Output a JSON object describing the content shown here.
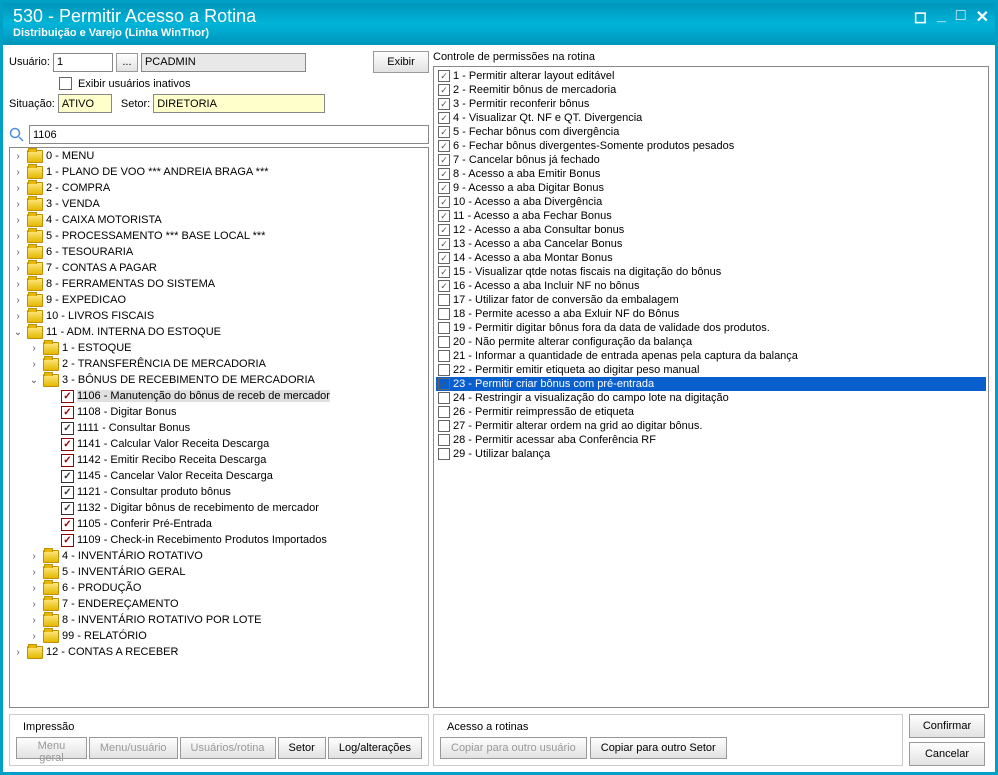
{
  "window": {
    "title": "530 - Permitir Acesso a Rotina",
    "subtitle": "Distribuição e Varejo (Linha WinThor)"
  },
  "form": {
    "user_label": "Usuário:",
    "user_id": "1",
    "user_name": "PCADMIN",
    "show_inactive": "Exibir usuários inativos",
    "exibir_btn": "Exibir",
    "situacao_label": "Situação:",
    "situacao": "ATIVO",
    "setor_label": "Setor:",
    "setor": "DIRETORIA",
    "search": "1106"
  },
  "tree": [
    {
      "i": 0,
      "t": ">",
      "f": 1,
      "label": "0 - MENU"
    },
    {
      "i": 0,
      "t": ">",
      "f": 1,
      "label": "1 - PLANO DE VOO    *** ANDREIA BRAGA ***"
    },
    {
      "i": 0,
      "t": ">",
      "f": 1,
      "label": "2 - COMPRA"
    },
    {
      "i": 0,
      "t": ">",
      "f": 1,
      "label": "3 - VENDA"
    },
    {
      "i": 0,
      "t": ">",
      "f": 1,
      "label": "4 - CAIXA MOTORISTA"
    },
    {
      "i": 0,
      "t": ">",
      "f": 1,
      "label": "5 - PROCESSAMENTO  *** BASE LOCAL ***"
    },
    {
      "i": 0,
      "t": ">",
      "f": 1,
      "label": "6 - TESOURARIA"
    },
    {
      "i": 0,
      "t": ">",
      "f": 1,
      "label": "7 - CONTAS A PAGAR"
    },
    {
      "i": 0,
      "t": ">",
      "f": 1,
      "label": "8 - FERRAMENTAS DO SISTEMA"
    },
    {
      "i": 0,
      "t": ">",
      "f": 1,
      "label": "9 - EXPEDICAO"
    },
    {
      "i": 0,
      "t": ">",
      "f": 1,
      "label": "10 - LIVROS FISCAIS"
    },
    {
      "i": 0,
      "t": "v",
      "f": 1,
      "label": "11 - ADM. INTERNA DO ESTOQUE"
    },
    {
      "i": 1,
      "t": ">",
      "f": 1,
      "label": "1 - ESTOQUE"
    },
    {
      "i": 1,
      "t": ">",
      "f": 1,
      "label": "2 - TRANSFERÊNCIA DE MERCADORIA"
    },
    {
      "i": 1,
      "t": "v",
      "f": 1,
      "label": "3 - BÔNUS DE RECEBIMENTO DE MERCADORIA"
    },
    {
      "i": 2,
      "c": "r",
      "label": "1106 - Manutenção do bônus de receb de mercador",
      "hl": 1
    },
    {
      "i": 2,
      "c": "r",
      "label": "1108 - Digitar Bonus"
    },
    {
      "i": 2,
      "c": "b",
      "label": "1111 - Consultar Bonus"
    },
    {
      "i": 2,
      "c": "r",
      "label": "1141 - Calcular  Valor Receita Descarga"
    },
    {
      "i": 2,
      "c": "r",
      "label": "1142 - Emitir Recibo Receita Descarga"
    },
    {
      "i": 2,
      "c": "b",
      "label": "1145 - Cancelar  Valor Receita Descarga"
    },
    {
      "i": 2,
      "c": "b",
      "label": "1121 - Consultar produto bônus"
    },
    {
      "i": 2,
      "c": "b",
      "label": "1132 - Digitar bônus de recebimento de mercador"
    },
    {
      "i": 2,
      "c": "r",
      "label": "1105 - Conferir Pré-Entrada"
    },
    {
      "i": 2,
      "c": "r",
      "label": "1109 - Check-in Recebimento Produtos Importados"
    },
    {
      "i": 1,
      "t": ">",
      "f": 1,
      "label": "4 - INVENTÁRIO ROTATIVO"
    },
    {
      "i": 1,
      "t": ">",
      "f": 1,
      "label": "5 - INVENTÁRIO GERAL"
    },
    {
      "i": 1,
      "t": ">",
      "f": 1,
      "label": "6 - PRODUÇÃO"
    },
    {
      "i": 1,
      "t": ">",
      "f": 1,
      "label": "7 - ENDEREÇAMENTO"
    },
    {
      "i": 1,
      "t": ">",
      "f": 1,
      "label": "8 - INVENTÁRIO ROTATIVO POR LOTE"
    },
    {
      "i": 1,
      "t": ">",
      "f": 1,
      "label": "99 - RELATÓRIO"
    },
    {
      "i": 0,
      "t": ">",
      "f": 1,
      "label": "12 - CONTAS A RECEBER"
    }
  ],
  "perm_title": "Controle de permissões na rotina",
  "perms": [
    {
      "c": 1,
      "label": "1 - Permitir alterar layout editável"
    },
    {
      "c": 1,
      "label": "2 - Reemitir bônus de mercadoria"
    },
    {
      "c": 1,
      "label": "3 - Permitir reconferir bônus"
    },
    {
      "c": 1,
      "label": "4 - Visualizar Qt. NF e QT. Divergencia"
    },
    {
      "c": 1,
      "label": "5 - Fechar bônus com divergência"
    },
    {
      "c": 1,
      "label": "6 - Fechar bônus divergentes-Somente produtos pesados"
    },
    {
      "c": 1,
      "label": "7 - Cancelar bônus já fechado"
    },
    {
      "c": 1,
      "label": "8 - Acesso a aba Emitir Bonus"
    },
    {
      "c": 1,
      "label": "9 - Acesso a aba Digitar Bonus"
    },
    {
      "c": 1,
      "label": "10 - Acesso a aba Divergência"
    },
    {
      "c": 1,
      "label": "11 - Acesso a aba Fechar Bonus"
    },
    {
      "c": 1,
      "label": "12 - Acesso a aba Consultar bonus"
    },
    {
      "c": 1,
      "label": "13 - Acesso a aba Cancelar Bonus"
    },
    {
      "c": 1,
      "label": "14 - Acesso a aba Montar Bonus"
    },
    {
      "c": 1,
      "label": "15 - Visualizar qtde notas fiscais na digitação do bônus"
    },
    {
      "c": 1,
      "label": "16 - Acesso a aba Incluir NF no bônus"
    },
    {
      "c": 0,
      "label": "17 - Utilizar fator de conversão da embalagem"
    },
    {
      "c": 0,
      "label": "18 - Permite acesso a aba Exluir NF do Bônus"
    },
    {
      "c": 0,
      "label": "19 - Permitir digitar bônus fora da data de validade dos produtos."
    },
    {
      "c": 0,
      "label": "20 - Não permite alterar configuração da balança"
    },
    {
      "c": 0,
      "label": "21 - Informar a quantidade de entrada apenas pela captura da balança"
    },
    {
      "c": 0,
      "label": "22 - Permitir emitir etiqueta ao digitar peso manual"
    },
    {
      "c": 1,
      "label": "23 - Permitir criar bônus com pré-entrada",
      "sel": 1
    },
    {
      "c": 0,
      "label": "24 - Restringir a visualização do campo lote na digitação"
    },
    {
      "c": 0,
      "label": "26 - Permitir reimpressão de etiqueta"
    },
    {
      "c": 0,
      "label": "27 - Permitir alterar ordem na grid ao digitar bônus."
    },
    {
      "c": 0,
      "label": "28 - Permitir acessar aba Conferência RF"
    },
    {
      "c": 0,
      "label": "29 - Utilizar balança"
    }
  ],
  "bottom": {
    "impressao": "Impressão",
    "acesso": "Acesso a rotinas",
    "menu_geral": "Menu geral",
    "menu_usuario": "Menu/usuário",
    "usuarios_rotina": "Usuários/rotina",
    "setor": "Setor",
    "log": "Log/alterações",
    "copiar_usuario": "Copiar para outro usuário",
    "copiar_setor": "Copiar para outro Setor",
    "confirmar": "Confirmar",
    "cancelar": "Cancelar"
  }
}
